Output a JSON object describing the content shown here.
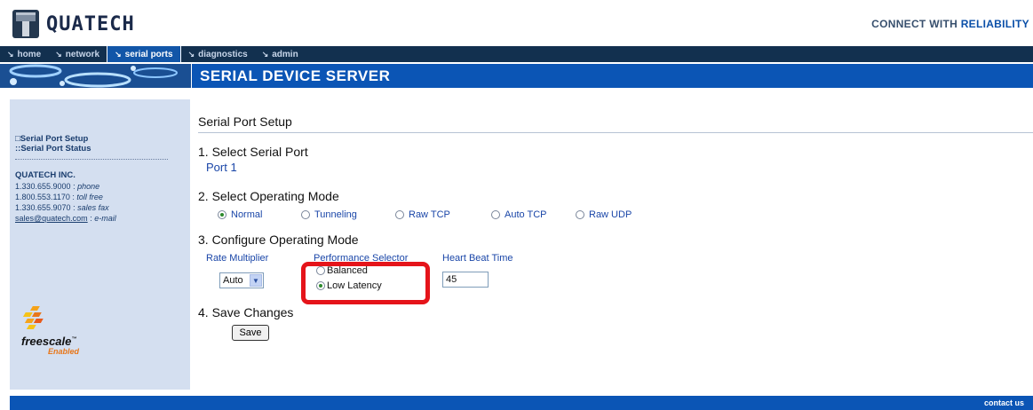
{
  "header": {
    "logo_text": "QUATECH",
    "tagline_prefix": "CONNECT WITH ",
    "tagline_accent": "RELIABILITY"
  },
  "nav": {
    "items": [
      {
        "label": "home",
        "active": false
      },
      {
        "label": "network",
        "active": false
      },
      {
        "label": "serial ports",
        "active": true
      },
      {
        "label": "diagnostics",
        "active": false
      },
      {
        "label": "admin",
        "active": false
      }
    ]
  },
  "banner": {
    "title": "SERIAL DEVICE SERVER"
  },
  "sidebar": {
    "links": [
      "Serial Port Setup",
      "Serial Port Status"
    ],
    "company": "QUATECH INC.",
    "contacts": [
      {
        "value": "1.330.655.9000",
        "type": "phone"
      },
      {
        "value": "1.800.553.1170",
        "type": "toll free"
      },
      {
        "value": "1.330.655.9070",
        "type": "sales fax"
      },
      {
        "value": "sales@quatech.com",
        "type": "e-mail"
      }
    ],
    "partner": {
      "name": "freescale",
      "tm": "™",
      "sub": "Enabled"
    }
  },
  "main": {
    "page_title": "Serial Port Setup",
    "section1": {
      "heading": "1. Select Serial Port",
      "value": "Port 1"
    },
    "section2": {
      "heading": "2. Select Operating Mode",
      "modes": [
        "Normal",
        "Tunneling",
        "Raw TCP",
        "Auto TCP",
        "Raw UDP"
      ],
      "selected": "Normal"
    },
    "section3": {
      "heading": "3. Configure Operating Mode",
      "rate_label": "Rate Multiplier",
      "rate_value": "Auto",
      "perf_label": "Performance Selector",
      "perf_options": [
        "Balanced",
        "Low Latency"
      ],
      "perf_selected": "Low Latency",
      "heartbeat_label": "Heart Beat Time",
      "heartbeat_value": "45"
    },
    "section4": {
      "heading": "4. Save Changes",
      "save_label": "Save"
    }
  },
  "footer": {
    "link": "contact us"
  },
  "colors": {
    "nav_bg": "#12304f",
    "accent_blue": "#0b55b5",
    "highlight_red": "#e5141a",
    "sidebar_bg": "#d4dff0"
  }
}
